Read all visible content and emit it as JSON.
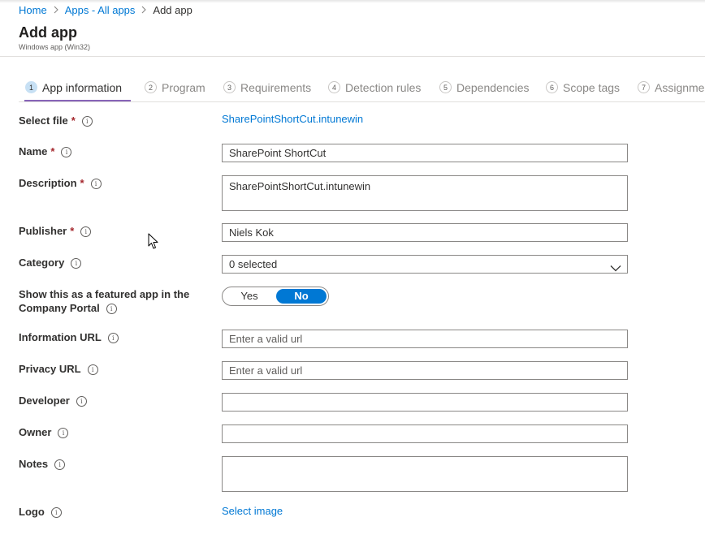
{
  "breadcrumb": {
    "items": [
      "Home",
      "Apps - All apps"
    ],
    "current": "Add app"
  },
  "header": {
    "title": "Add app",
    "subtitle": "Windows app (Win32)"
  },
  "tabs": [
    {
      "num": "1",
      "label": "App information",
      "active": true
    },
    {
      "num": "2",
      "label": "Program"
    },
    {
      "num": "3",
      "label": "Requirements"
    },
    {
      "num": "4",
      "label": "Detection rules"
    },
    {
      "num": "5",
      "label": "Dependencies"
    },
    {
      "num": "6",
      "label": "Scope tags"
    },
    {
      "num": "7",
      "label": "Assignments"
    }
  ],
  "form": {
    "select_file": {
      "label": "Select file",
      "required": true,
      "value": "SharePointShortCut.intunewin"
    },
    "name": {
      "label": "Name",
      "required": true,
      "value": "SharePoint ShortCut"
    },
    "description": {
      "label": "Description",
      "required": true,
      "value": "SharePointShortCut.intunewin"
    },
    "publisher": {
      "label": "Publisher",
      "required": true,
      "value": "Niels Kok"
    },
    "category": {
      "label": "Category",
      "value": "0 selected"
    },
    "featured": {
      "label_line1": "Show this as a featured app in the",
      "label_line2": "Company Portal",
      "yes": "Yes",
      "no": "No",
      "selected": "No"
    },
    "information_url": {
      "label": "Information URL",
      "placeholder": "Enter a valid url"
    },
    "privacy_url": {
      "label": "Privacy URL",
      "placeholder": "Enter a valid url"
    },
    "developer": {
      "label": "Developer",
      "value": ""
    },
    "owner": {
      "label": "Owner",
      "value": ""
    },
    "notes": {
      "label": "Notes",
      "value": ""
    },
    "logo": {
      "label": "Logo",
      "link": "Select image"
    }
  },
  "required_marker": "*",
  "info_glyph": "i",
  "colors": {
    "accent": "#0078d4",
    "tab_underline": "#8764b8",
    "required": "#a4262c"
  }
}
